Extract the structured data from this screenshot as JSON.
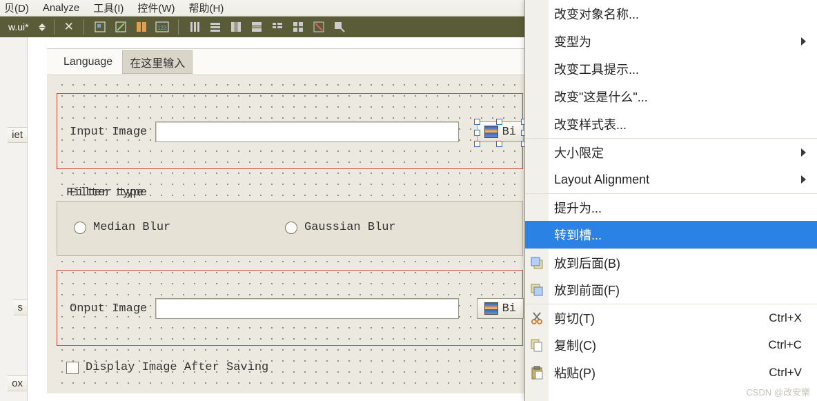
{
  "menubar": [
    "贝(D)",
    "Analyze",
    "工具(I)",
    "控件(W)",
    "帮助(H)"
  ],
  "window_title_fragment": "w.ui*",
  "canvas": {
    "tabs": {
      "language": "Language",
      "edit_here": "在这里输入"
    },
    "input_label": "Input Image",
    "output_label": "Onput Image",
    "filter_title": "Filter type",
    "radio_median": "Median Blur",
    "radio_gaussian": "Gaussian Blur",
    "browse_fragment": "Bi",
    "checkbox_label": "Display Image After Saving"
  },
  "left_stubs": [
    "iet",
    "s",
    "ox"
  ],
  "context_menu": [
    {
      "label": "改变对象名称...",
      "type": "item"
    },
    {
      "label": "变型为",
      "type": "submenu"
    },
    {
      "label": "改变工具提示...",
      "type": "item"
    },
    {
      "label": "改变\"这是什么\"...",
      "type": "item"
    },
    {
      "label": "改变样式表...",
      "type": "item"
    },
    {
      "label": "大小限定",
      "type": "submenu",
      "sep": true
    },
    {
      "label": "Layout Alignment",
      "type": "submenu"
    },
    {
      "label": "提升为...",
      "type": "item",
      "sep": true
    },
    {
      "label": "转到槽...",
      "type": "item",
      "highlight": true
    },
    {
      "label": "放到后面(B)",
      "type": "item",
      "icon": "send-back",
      "sep": true
    },
    {
      "label": "放到前面(F)",
      "type": "item",
      "icon": "send-front"
    },
    {
      "label": "剪切(T)",
      "type": "item",
      "shortcut": "Ctrl+X",
      "icon": "cut",
      "sep": true
    },
    {
      "label": "复制(C)",
      "type": "item",
      "shortcut": "Ctrl+C",
      "icon": "copy"
    },
    {
      "label": "粘贴(P)",
      "type": "item",
      "shortcut": "Ctrl+V",
      "icon": "paste"
    }
  ],
  "watermark": "CSDN @改安樂"
}
